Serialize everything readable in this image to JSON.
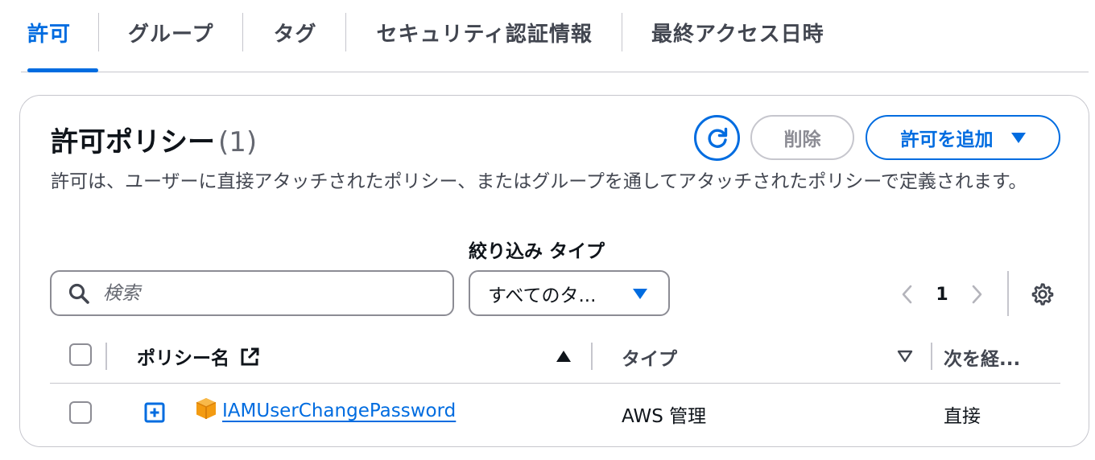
{
  "tabs": [
    {
      "label": "許可",
      "active": true
    },
    {
      "label": "グループ",
      "active": false
    },
    {
      "label": "タグ",
      "active": false
    },
    {
      "label": "セキュリティ認証情報",
      "active": false
    },
    {
      "label": "最終アクセス日時",
      "active": false
    }
  ],
  "panel": {
    "title": "許可ポリシー",
    "count": "(1)",
    "refresh_icon": "refresh-icon",
    "delete_label": "削除",
    "add_label": "許可を追加",
    "description": "許可は、ユーザーに直接アタッチされたポリシー、またはグループを通してアタッチされたポリシーで定義されます。"
  },
  "filter": {
    "label": "絞り込み タイプ",
    "search_placeholder": "検索",
    "select_value": "すべてのタ..."
  },
  "pagination": {
    "current_page": "1"
  },
  "table": {
    "headers": {
      "policy_name": "ポリシー名",
      "type": "タイプ",
      "attached_via": "次を経..."
    },
    "sort": {
      "policy_name": "ascending",
      "type": "none"
    },
    "rows": [
      {
        "name": "IAMUserChangePassword",
        "type": "AWS 管理",
        "attached_via": "直接"
      }
    ]
  },
  "colors": {
    "accent": "#006ce0",
    "text": "#0f141a",
    "border": "#c6c6cd",
    "aws_icon": "#f39b12"
  }
}
